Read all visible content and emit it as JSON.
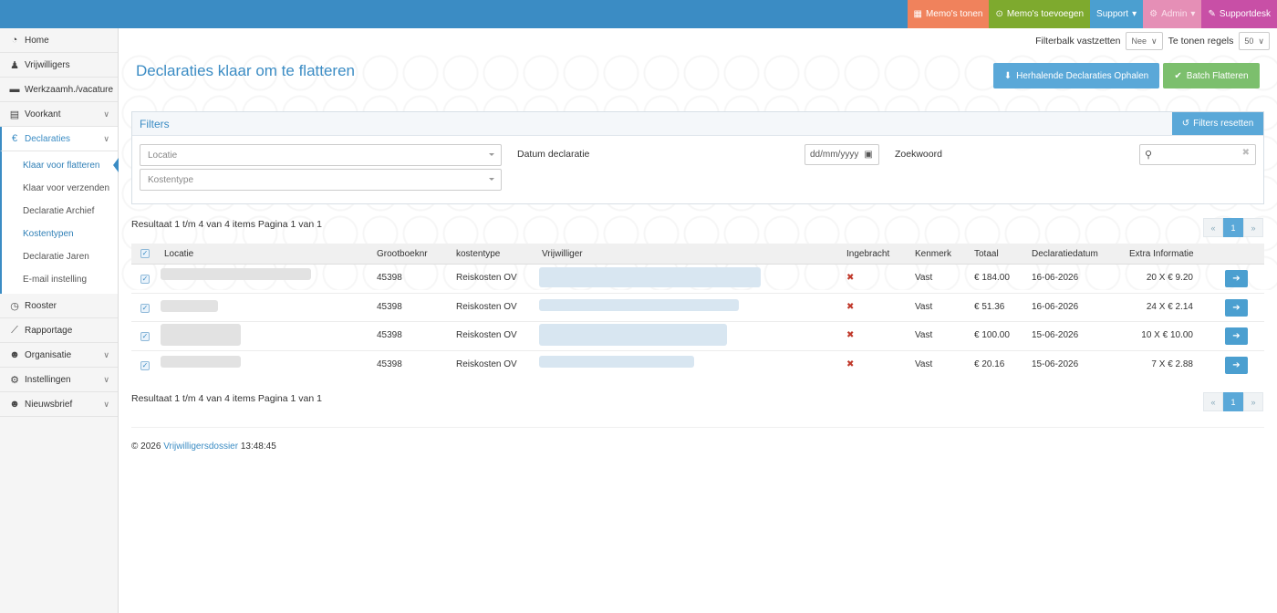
{
  "topbar": {
    "memo_tonen": "Memo's tonen",
    "memo_toevoegen": "Memo's toevoegen",
    "support": "Support",
    "admin": "Admin",
    "supportdesk": "Supportdesk"
  },
  "sidebar": {
    "items": [
      {
        "label": "Home",
        "icon": "dashboard-icon"
      },
      {
        "label": "Vrijwilligers",
        "icon": "person-icon"
      },
      {
        "label": "Werkzaamh./vacature",
        "icon": "folder-icon"
      },
      {
        "label": "Voorkant",
        "icon": "newspaper-icon"
      },
      {
        "label": "Declaraties",
        "icon": "euro-icon"
      },
      {
        "label": "Rooster",
        "icon": "clock-icon"
      },
      {
        "label": "Rapportage",
        "icon": "chart-icon"
      },
      {
        "label": "Organisatie",
        "icon": "users-icon"
      },
      {
        "label": "Instellingen",
        "icon": "gear-icon"
      },
      {
        "label": "Nieuwsbrief",
        "icon": "users-icon"
      }
    ],
    "sub": [
      "Klaar voor flatteren",
      "Klaar voor verzenden",
      "Declaratie Archief",
      "Kostentypen",
      "Declaratie Jaren",
      "E-mail instelling"
    ]
  },
  "options": {
    "filterbalk_label": "Filterbalk vastzetten",
    "filterbalk_value": "Nee",
    "regels_label": "Te tonen regels",
    "regels_value": "50"
  },
  "page": {
    "title": "Declaraties klaar om te flatteren",
    "btn_herhalende": "Herhalende Declaraties Ophalen",
    "btn_batch": "Batch Flatteren"
  },
  "filters": {
    "title": "Filters",
    "reset": "Filters resetten",
    "locatie_placeholder": "Locatie",
    "kostentype_placeholder": "Kostentype",
    "datum_label": "Datum declaratie",
    "datum_placeholder": "dd/mm/yyyy",
    "zoekwoord_label": "Zoekwoord"
  },
  "result_text": "Resultaat 1 t/m 4 van 4 items Pagina 1 van 1",
  "pager": {
    "prev": "«",
    "page": "1",
    "next": "»"
  },
  "table": {
    "headers": [
      "Locatie",
      "Grootboeknr",
      "kostentype",
      "Vrijwilliger",
      "Ingebracht",
      "Kenmerk",
      "Totaal",
      "Declaratiedatum",
      "Extra Informatie"
    ],
    "rows": [
      {
        "grootboek": "45398",
        "kostentype": "Reiskosten OV",
        "kenmerk": "Vast",
        "totaal": "€ 184.00",
        "datum": "16-06-2026",
        "extra": "20 X € 9.20"
      },
      {
        "grootboek": "45398",
        "kostentype": "Reiskosten OV",
        "kenmerk": "Vast",
        "totaal": "€ 51.36",
        "datum": "16-06-2026",
        "extra": "24 X € 2.14"
      },
      {
        "grootboek": "45398",
        "kostentype": "Reiskosten OV",
        "kenmerk": "Vast",
        "totaal": "€ 100.00",
        "datum": "15-06-2026",
        "extra": "10 X € 10.00"
      },
      {
        "grootboek": "45398",
        "kostentype": "Reiskosten OV",
        "kenmerk": "Vast",
        "totaal": "€ 20.16",
        "datum": "15-06-2026",
        "extra": "7 X € 2.88"
      }
    ]
  },
  "footer": {
    "copyright": "© 2026",
    "link": "Vrijwilligersdossier",
    "time": "13:48:45"
  }
}
